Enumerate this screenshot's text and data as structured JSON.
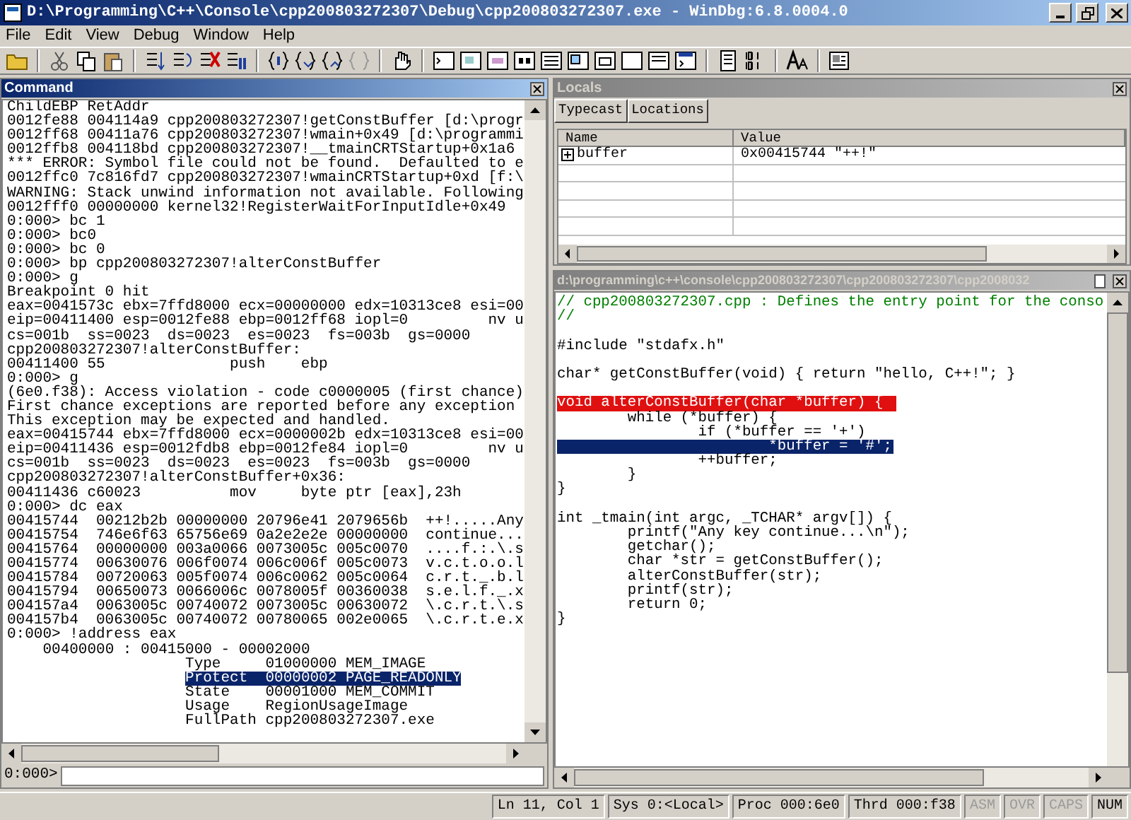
{
  "window": {
    "title": "D:\\Programming\\C++\\Console\\cpp200803272307\\Debug\\cpp200803272307.exe - WinDbg:6.8.0004.0"
  },
  "menu": [
    "File",
    "Edit",
    "View",
    "Debug",
    "Window",
    "Help"
  ],
  "command_pane": {
    "title": "Command",
    "prompt": "0:000>",
    "lines": [
      {
        "text": "ChildEBP RetAddr",
        "selected": false
      },
      {
        "text": "0012fe88 004114a9 cpp200803272307!getConstBuffer [d:\\progr",
        "selected": false
      },
      {
        "text": "0012ff68 00411a76 cpp200803272307!wmain+0x49 [d:\\programmi",
        "selected": false
      },
      {
        "text": "0012ffb8 004118bd cpp200803272307!__tmainCRTStartup+0x1a6",
        "selected": false
      },
      {
        "text": "*** ERROR: Symbol file could not be found.  Defaulted to e",
        "selected": false
      },
      {
        "text": "0012ffc0 7c816fd7 cpp200803272307!wmainCRTStartup+0xd [f:\\",
        "selected": false
      },
      {
        "text": "WARNING: Stack unwind information not available. Following",
        "selected": false
      },
      {
        "text": "0012fff0 00000000 kernel32!RegisterWaitForInputIdle+0x49",
        "selected": false
      },
      {
        "text": "0:000> bc 1",
        "selected": false
      },
      {
        "text": "0:000> bc0",
        "selected": false
      },
      {
        "text": "0:000> bc 0",
        "selected": false
      },
      {
        "text": "0:000> bp cpp200803272307!alterConstBuffer",
        "selected": false
      },
      {
        "text": "0:000> g",
        "selected": false
      },
      {
        "text": "Breakpoint 0 hit",
        "selected": false
      },
      {
        "text": "eax=0041573c ebx=7ffd8000 ecx=00000000 edx=10313ce8 esi=00",
        "selected": false
      },
      {
        "text": "eip=00411400 esp=0012fe88 ebp=0012ff68 iopl=0         nv u",
        "selected": false
      },
      {
        "text": "cs=001b  ss=0023  ds=0023  es=0023  fs=003b  gs=0000",
        "selected": false
      },
      {
        "text": "cpp200803272307!alterConstBuffer:",
        "selected": false
      },
      {
        "text": "00411400 55              push    ebp",
        "selected": false
      },
      {
        "text": "0:000> g",
        "selected": false
      },
      {
        "text": "(6e0.f38): Access violation - code c0000005 (first chance)",
        "selected": false
      },
      {
        "text": "First chance exceptions are reported before any exception",
        "selected": false
      },
      {
        "text": "This exception may be expected and handled.",
        "selected": false
      },
      {
        "text": "eax=00415744 ebx=7ffd8000 ecx=0000002b edx=10313ce8 esi=00",
        "selected": false
      },
      {
        "text": "eip=00411436 esp=0012fdb8 ebp=0012fe84 iopl=0         nv u",
        "selected": false
      },
      {
        "text": "cs=001b  ss=0023  ds=0023  es=0023  fs=003b  gs=0000",
        "selected": false
      },
      {
        "text": "cpp200803272307!alterConstBuffer+0x36:",
        "selected": false
      },
      {
        "text": "00411436 c60023          mov     byte ptr [eax],23h",
        "selected": false
      },
      {
        "text": "0:000> dc eax",
        "selected": false
      },
      {
        "text": "00415744  00212b2b 00000000 20796e41 2079656b  ++!.....Any",
        "selected": false
      },
      {
        "text": "00415754  746e6f63 65756e69 0a2e2e2e 00000000  continue...",
        "selected": false
      },
      {
        "text": "00415764  00000000 003a0066 0073005c 005c0070  ....f.:.\\.s",
        "selected": false
      },
      {
        "text": "00415774  00630076 006f0074 006c006f 005c0073  v.c.t.o.o.l",
        "selected": false
      },
      {
        "text": "00415784  00720063 005f0074 006c0062 005c0064  c.r.t._.b.l",
        "selected": false
      },
      {
        "text": "00415794  00650073 0066006c 0078005f 00360038  s.e.l.f._.x",
        "selected": false
      },
      {
        "text": "004157a4  0063005c 00740072 0073005c 00630072  \\.c.r.t.\\.s",
        "selected": false
      },
      {
        "text": "004157b4  0063005c 00740072 00780065 002e0065  \\.c.r.t.e.x",
        "selected": false
      },
      {
        "text": "0:000> !address eax",
        "selected": false
      },
      {
        "text": "    00400000 : 00415000 - 00002000",
        "selected": false
      },
      {
        "text": "                    Type     01000000 MEM_IMAGE",
        "selected": false
      },
      {
        "text": "                    Protect  00000002 PAGE_READONLY",
        "selected": true
      },
      {
        "text": "                    State    00001000 MEM_COMMIT",
        "selected": false
      },
      {
        "text": "                    Usage    RegionUsageImage",
        "selected": false
      },
      {
        "text": "                    FullPath cpp200803272307.exe",
        "selected": false
      }
    ]
  },
  "locals_pane": {
    "title": "Locals",
    "buttons": [
      "Typecast",
      "Locations"
    ],
    "columns": [
      "Name",
      "Value"
    ],
    "rows": [
      {
        "name": "buffer",
        "value": "0x00415744 \"++!\"",
        "expanded": false
      }
    ]
  },
  "source_pane": {
    "title": "d:\\programming\\c++\\console\\cpp200803272307\\cpp200803272307\\cpp2008032",
    "lines": [
      {
        "kind": "comment",
        "text": "// cpp200803272307.cpp : Defines the entry point for the conso"
      },
      {
        "kind": "comment",
        "text": "//"
      },
      {
        "kind": "blank"
      },
      {
        "kind": "code",
        "text": "#include \"stdafx.h\""
      },
      {
        "kind": "blank"
      },
      {
        "kind": "code",
        "text": "char* getConstBuffer(void) { return \"hello, C++!\"; }"
      },
      {
        "kind": "blank"
      },
      {
        "kind": "breakpoint",
        "text": "void alterConstBuffer(char *buffer) {"
      },
      {
        "kind": "code",
        "text": "        while (*buffer) {"
      },
      {
        "kind": "code",
        "text": "                if (*buffer == '+')"
      },
      {
        "kind": "current",
        "text": "                        *buffer = '#';"
      },
      {
        "kind": "code",
        "text": "                ++buffer;"
      },
      {
        "kind": "code",
        "text": "        }"
      },
      {
        "kind": "code",
        "text": "}"
      },
      {
        "kind": "blank"
      },
      {
        "kind": "code",
        "text": "int _tmain(int argc, _TCHAR* argv[]) {"
      },
      {
        "kind": "code",
        "text": "        printf(\"Any key continue...\\n\");"
      },
      {
        "kind": "code",
        "text": "        getchar();"
      },
      {
        "kind": "code",
        "text": "        char *str = getConstBuffer();"
      },
      {
        "kind": "code",
        "text": "        alterConstBuffer(str);"
      },
      {
        "kind": "code",
        "text": "        printf(str);"
      },
      {
        "kind": "code",
        "text": "        return 0;"
      },
      {
        "kind": "code",
        "text": "}"
      }
    ]
  },
  "status_bar": [
    {
      "text": "Ln 11, Col 1",
      "disabled": false
    },
    {
      "text": "Sys 0:<Local>",
      "disabled": false
    },
    {
      "text": "Proc 000:6e0",
      "disabled": false
    },
    {
      "text": "Thrd 000:f38",
      "disabled": false
    },
    {
      "text": "ASM",
      "disabled": true
    },
    {
      "text": "OVR",
      "disabled": true
    },
    {
      "text": "CAPS",
      "disabled": true
    },
    {
      "text": "NUM",
      "disabled": false
    }
  ]
}
